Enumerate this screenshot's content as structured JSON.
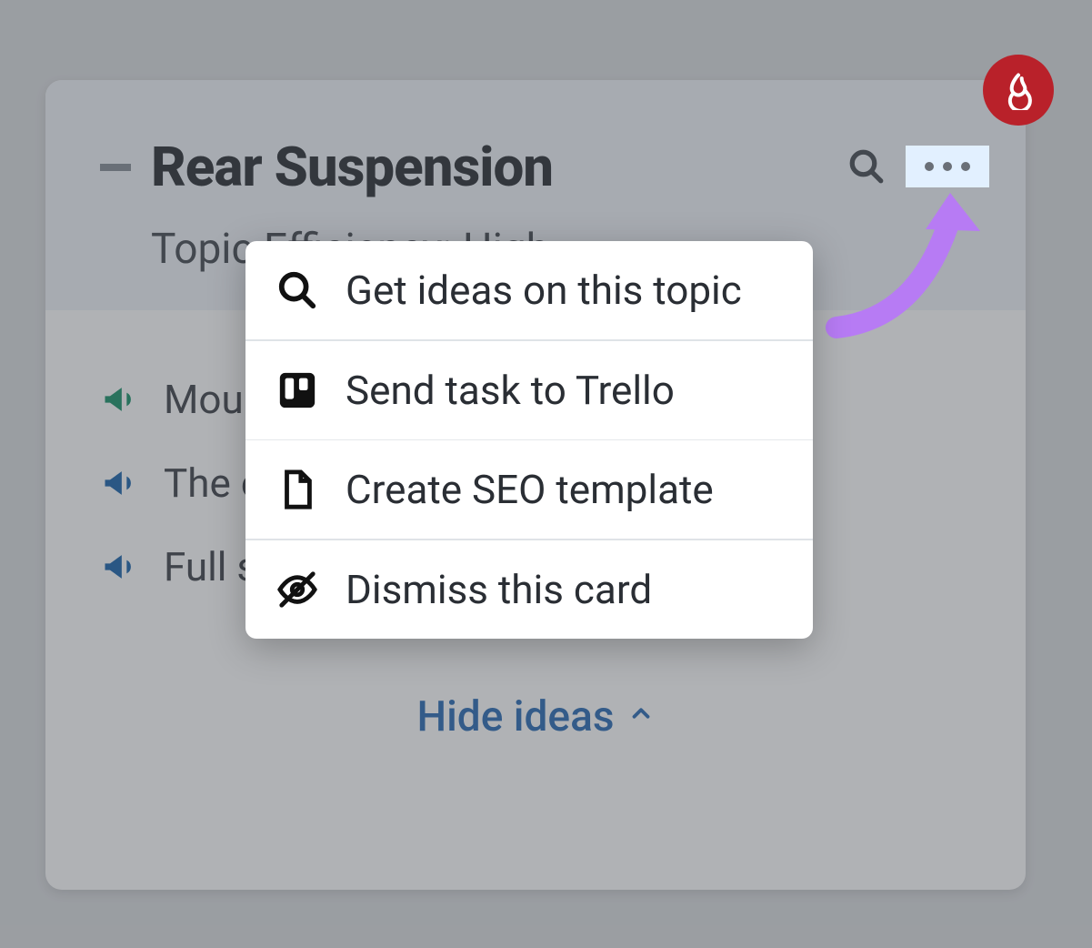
{
  "card": {
    "title": "Rear Suspension",
    "efficiency_label": "Topic Efficiency: High"
  },
  "ideas": [
    {
      "color": "green",
      "text": "Mou…"
    },
    {
      "color": "blue",
      "text": "The                                            e rear ..."
    },
    {
      "color": "blue",
      "text": "Full suspension mountain bikes"
    }
  ],
  "hide_label": "Hide ideas",
  "menu": {
    "items": [
      {
        "icon": "search",
        "label": "Get ideas on this topic"
      },
      {
        "icon": "trello",
        "label": "Send task to Trello"
      },
      {
        "icon": "file",
        "label": "Create SEO template"
      },
      {
        "icon": "eye-off",
        "label": "Dismiss this card"
      }
    ]
  }
}
